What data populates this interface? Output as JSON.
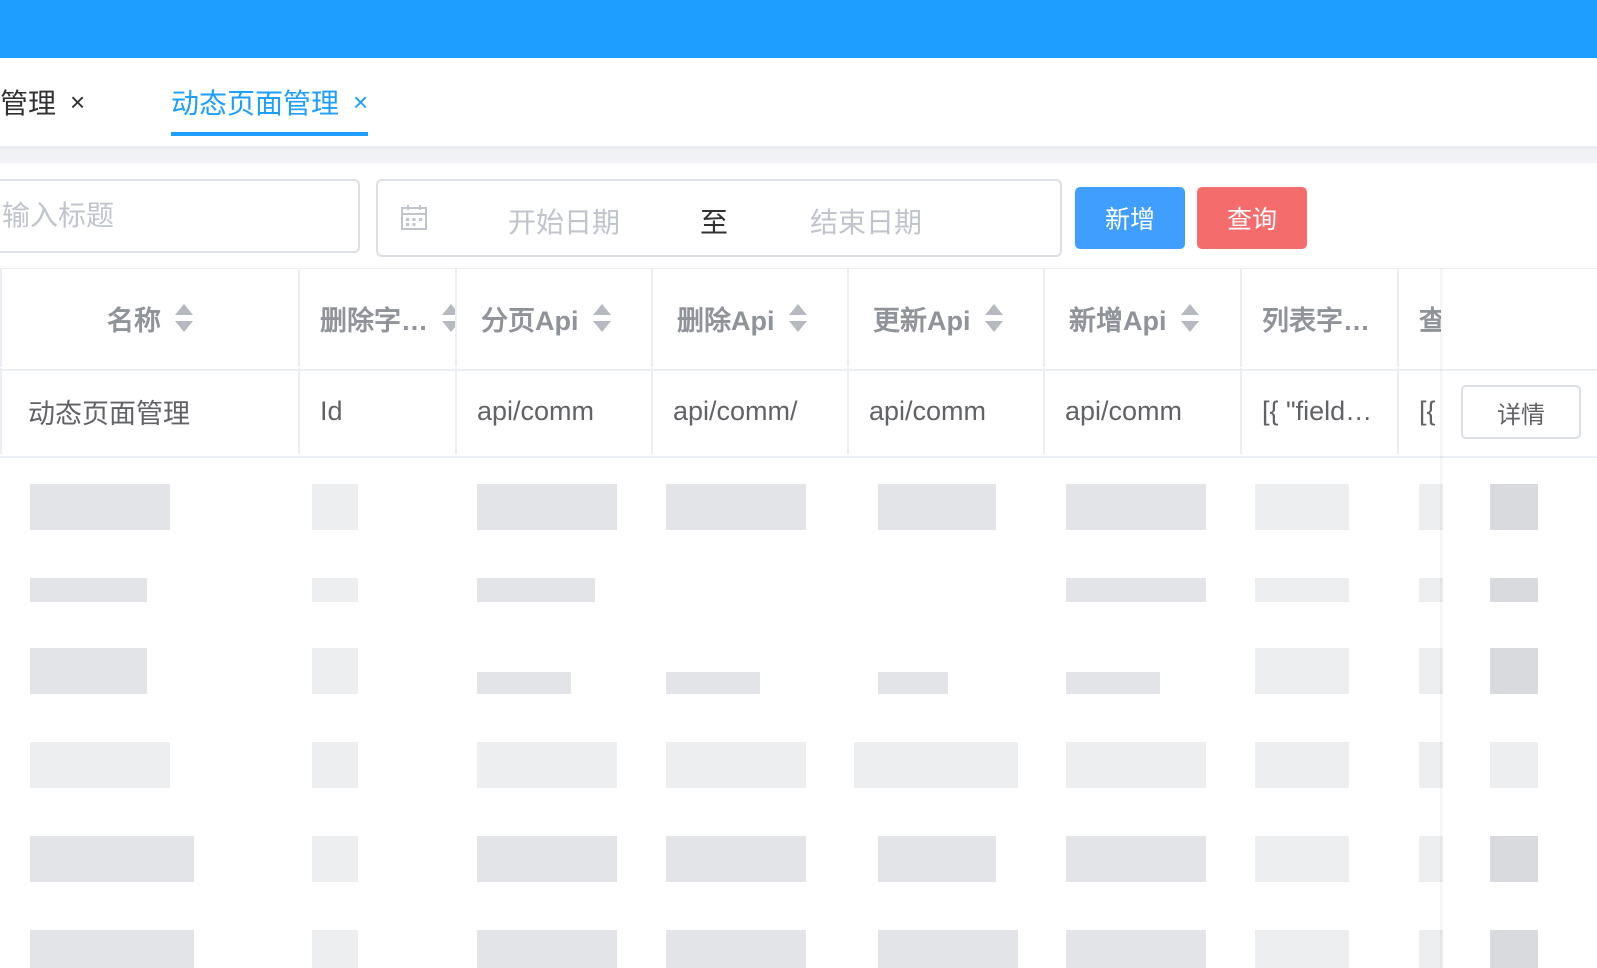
{
  "tabs": [
    {
      "label": "管理",
      "close": "×",
      "active": false
    },
    {
      "label": "动态页面管理",
      "close": "×",
      "active": true
    }
  ],
  "toolbar": {
    "title_placeholder": "输入标题",
    "start_placeholder": "开始日期",
    "range_separator": "至",
    "end_placeholder": "结束日期",
    "add_label": "新增",
    "query_label": "查询"
  },
  "table": {
    "headers": [
      "名称",
      "删除字…",
      "分页Api",
      "删除Api",
      "更新Api",
      "新增Api",
      "列表字…",
      "查"
    ],
    "rows": [
      {
        "cells": [
          "动态页面管理",
          "Id",
          "api/comm",
          "api/comm/",
          "api/comm",
          "api/comm",
          "[{ \"field…",
          "[{"
        ],
        "action": "详情"
      }
    ]
  },
  "colors": {
    "topbar": "#1e9fff",
    "accent": "#1e9fff",
    "add_button": "#409eff",
    "query_button": "#f56c6c"
  }
}
